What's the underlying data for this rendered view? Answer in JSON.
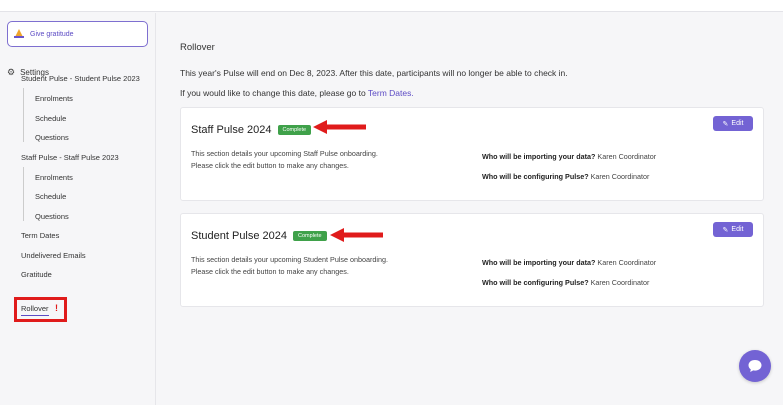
{
  "sidebar": {
    "gratitude_button": "Give gratitude",
    "settings_label": "Settings",
    "student_pulse_header": "Student Pulse - Student Pulse 2023",
    "student_items": [
      "Enrolments",
      "Schedule",
      "Questions"
    ],
    "staff_pulse_header": "Staff Pulse - Staff Pulse 2023",
    "staff_items": [
      "Enrolments",
      "Schedule",
      "Questions"
    ],
    "term_dates": "Term Dates",
    "undelivered_emails": "Undelivered Emails",
    "gratitude": "Gratitude",
    "rollover": "Rollover",
    "rollover_alert": "!"
  },
  "main": {
    "title": "Rollover",
    "end_text": "This year's Pulse will end on Dec 8, 2023. After this date, participants will no longer be able to check in.",
    "change_text": "If you would like to change this date, please go to ",
    "term_dates_link": "Term Dates."
  },
  "cards": [
    {
      "title": "Staff Pulse 2024",
      "badge": "Complete",
      "edit_label": "Edit",
      "desc_line1": "This section details your upcoming Staff Pulse onboarding.",
      "desc_line2": "Please click the edit button to make any changes.",
      "import_q": "Who will be importing your data?",
      "import_a": "Karen Coordinator",
      "config_q": "Who will be configuring Pulse?",
      "config_a": "Karen Coordinator"
    },
    {
      "title": "Student Pulse 2024",
      "badge": "Complete",
      "edit_label": "Edit",
      "desc_line1": "This section details your upcoming Student Pulse onboarding.",
      "desc_line2": "Please click the edit button to make any changes.",
      "import_q": "Who will be importing your data?",
      "import_a": "Karen Coordinator",
      "config_q": "Who will be configuring Pulse?",
      "config_a": "Karen Coordinator"
    }
  ],
  "colors": {
    "accent": "#7363d4",
    "complete": "#3fa14a",
    "annotation_red": "#e01b1b"
  },
  "icons": [
    "gratitude-icon",
    "gear-icon",
    "pencil-icon",
    "chat-icon"
  ]
}
